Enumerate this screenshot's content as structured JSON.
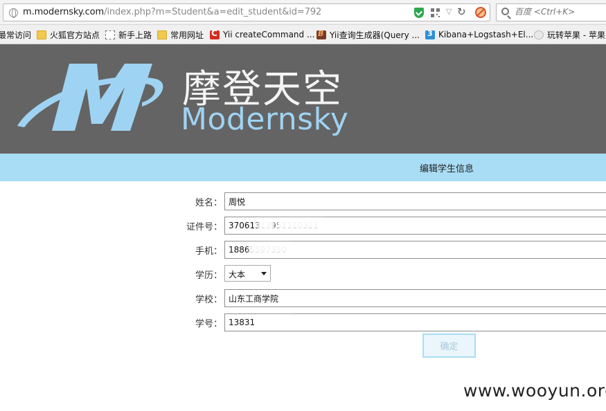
{
  "browser": {
    "url_host": "m.modernsky.com",
    "url_path": "/index.php?m=Student&a=edit_student&id=792",
    "search_placeholder": "百度 <Ctrl+K>"
  },
  "bookmarks": [
    {
      "label": "最常访问",
      "icon": "none"
    },
    {
      "label": "火狐官方站点",
      "icon": "folder-icon"
    },
    {
      "label": "新手上路",
      "icon": "page-icon"
    },
    {
      "label": "常用网址",
      "icon": "folder-icon"
    },
    {
      "label": "Yii createCommand ...",
      "icon": "yii-icon"
    },
    {
      "label": "Yii查询生成器(Query ...",
      "icon": "b3-icon"
    },
    {
      "label": "Kibana+Logstash+El...",
      "icon": "kibana-icon"
    },
    {
      "label": "玩转苹果 - 苹果",
      "icon": "apple-icon"
    }
  ],
  "banner": {
    "brand_cn": "摩登天空",
    "brand_en": "Modernsky",
    "logo_letter": "M",
    "colors": {
      "background": "#646464",
      "logo_blue": "#9fd3f3"
    }
  },
  "page": {
    "title": "编辑学生信息",
    "title_bar_color": "#a9ddf5"
  },
  "form": {
    "name_label": "姓名：",
    "name_value": "周悦",
    "id_label": "证件号：",
    "id_value": "37061313951110321",
    "phone_label": "手机：",
    "phone_value": "18865597350",
    "edu_label": "学历：",
    "edu_value": "大本",
    "school_label": "学校：",
    "school_value": "山东工商学院",
    "student_no_label": "学号：",
    "student_no_value": "13831",
    "submit_label": "确定"
  },
  "watermark": "www.wooyun.org"
}
